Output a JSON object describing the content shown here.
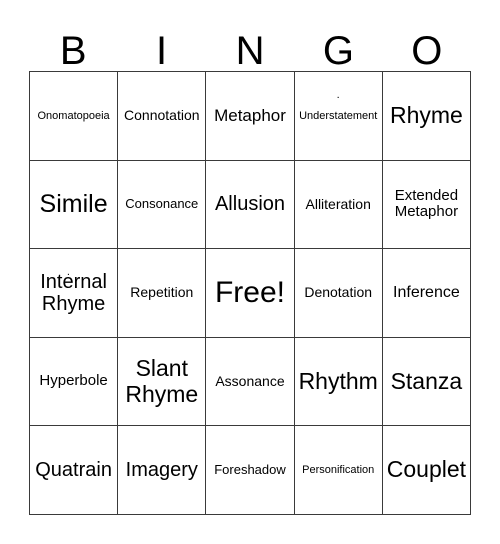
{
  "card": {
    "header_letters": [
      "B",
      "I",
      "N",
      "G",
      "O"
    ],
    "grid_size": 5,
    "border_color": "#3a3a3a",
    "background_color": "#ffffff",
    "text_color": "#000000",
    "rows": [
      [
        {
          "label": "Onomatopoeia",
          "size": "fs-xs",
          "marker": false,
          "stray_dot": ""
        },
        {
          "label": "Connotation",
          "size": "fs-sm",
          "marker": false,
          "stray_dot": ""
        },
        {
          "label": "Metaphor",
          "size": "fs-l",
          "marker": false,
          "stray_dot": ""
        },
        {
          "label": "Understatement",
          "size": "fs-xs",
          "marker": false,
          "stray_dot": "."
        },
        {
          "label": "Rhyme",
          "size": "fs-xxl",
          "marker": false,
          "stray_dot": ""
        }
      ],
      [
        {
          "label": "Simile",
          "size": "fs-xxxl",
          "marker": false,
          "stray_dot": ""
        },
        {
          "label": "Consonance",
          "size": "fs-s",
          "marker": false,
          "stray_dot": ""
        },
        {
          "label": "Allusion",
          "size": "fs-xl",
          "marker": false,
          "stray_dot": ""
        },
        {
          "label": "Alliteration",
          "size": "fs-sm",
          "marker": false,
          "stray_dot": ""
        },
        {
          "label": "Extended Metaphor",
          "size": "fs-m",
          "marker": false,
          "stray_dot": ""
        }
      ],
      [
        {
          "label": "Internal Rhyme",
          "size": "fs-xl",
          "marker": false,
          "stray_dot": "."
        },
        {
          "label": "Repetition",
          "size": "fs-sm",
          "marker": false,
          "stray_dot": ""
        },
        {
          "label": "Free!",
          "size": "fs-free",
          "marker": true,
          "stray_dot": ""
        },
        {
          "label": "Denotation",
          "size": "fs-sm",
          "marker": false,
          "stray_dot": ""
        },
        {
          "label": "Inference",
          "size": "fs-ml",
          "marker": false,
          "stray_dot": ""
        }
      ],
      [
        {
          "label": "Hyperbole",
          "size": "fs-m",
          "marker": false,
          "stray_dot": ""
        },
        {
          "label": "Slant Rhyme",
          "size": "fs-xxl",
          "marker": false,
          "stray_dot": ""
        },
        {
          "label": "Assonance",
          "size": "fs-sm",
          "marker": false,
          "stray_dot": ""
        },
        {
          "label": "Rhythm",
          "size": "fs-xxl",
          "marker": false,
          "stray_dot": ""
        },
        {
          "label": "Stanza",
          "size": "fs-xxl",
          "marker": false,
          "stray_dot": ""
        }
      ],
      [
        {
          "label": "Quatrain",
          "size": "fs-xl",
          "marker": false,
          "stray_dot": ""
        },
        {
          "label": "Imagery",
          "size": "fs-xl",
          "marker": false,
          "stray_dot": ""
        },
        {
          "label": "Foreshadow",
          "size": "fs-s",
          "marker": false,
          "stray_dot": ""
        },
        {
          "label": "Personification",
          "size": "fs-xs",
          "marker": false,
          "stray_dot": ""
        },
        {
          "label": "Couplet",
          "size": "fs-xxl",
          "marker": false,
          "stray_dot": ""
        }
      ]
    ]
  }
}
